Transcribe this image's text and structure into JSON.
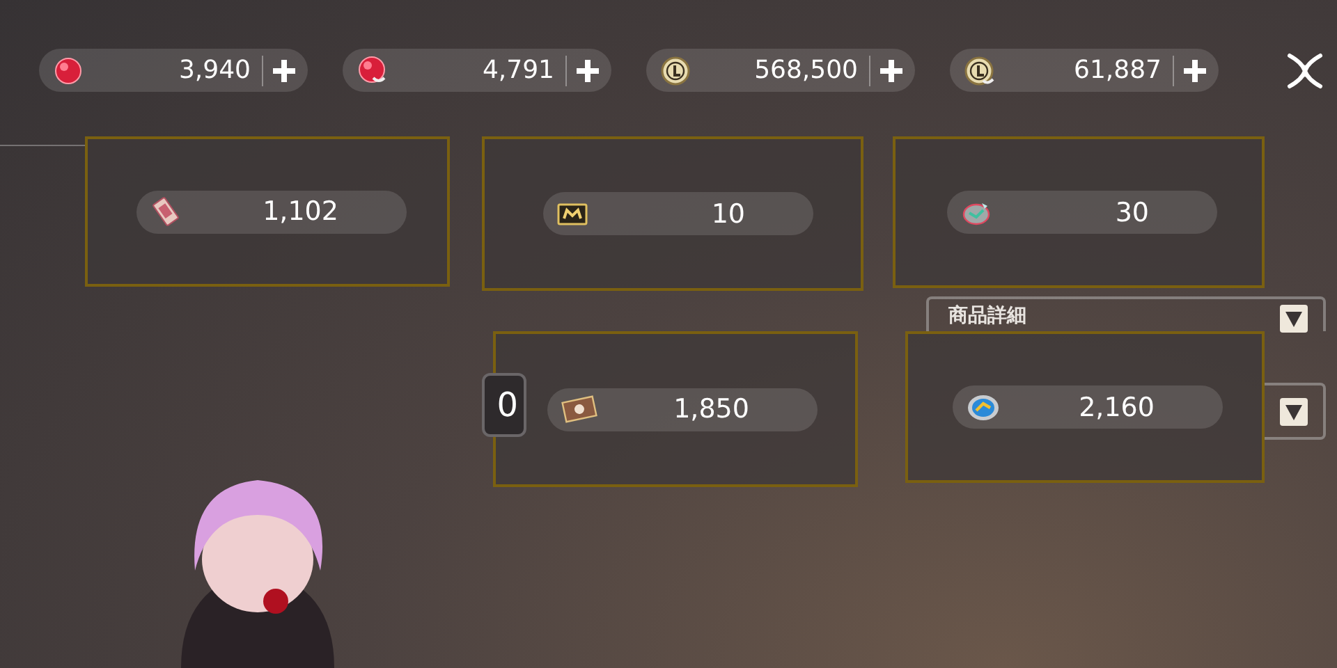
{
  "currencies": [
    {
      "kind": "ruby",
      "amount": "3,940"
    },
    {
      "kind": "ruby-bonus",
      "amount": "4,791"
    },
    {
      "kind": "coin",
      "amount": "568,500"
    },
    {
      "kind": "coin-bonus",
      "amount": "61,887"
    }
  ],
  "dropdowns": [
    {
      "kind": "labeled",
      "label": "商品詳細"
    },
    {
      "kind": "blank"
    }
  ],
  "price_tag": {
    "text": "0"
  },
  "panels": [
    {
      "kind": "ticket",
      "amount": "1,102"
    },
    {
      "kind": "m-ticket",
      "amount": "10"
    },
    {
      "kind": "gem-badge",
      "amount": "30"
    },
    {
      "kind": "stamp-card",
      "amount": "1,850"
    },
    {
      "kind": "medal",
      "amount": "2,160"
    }
  ]
}
